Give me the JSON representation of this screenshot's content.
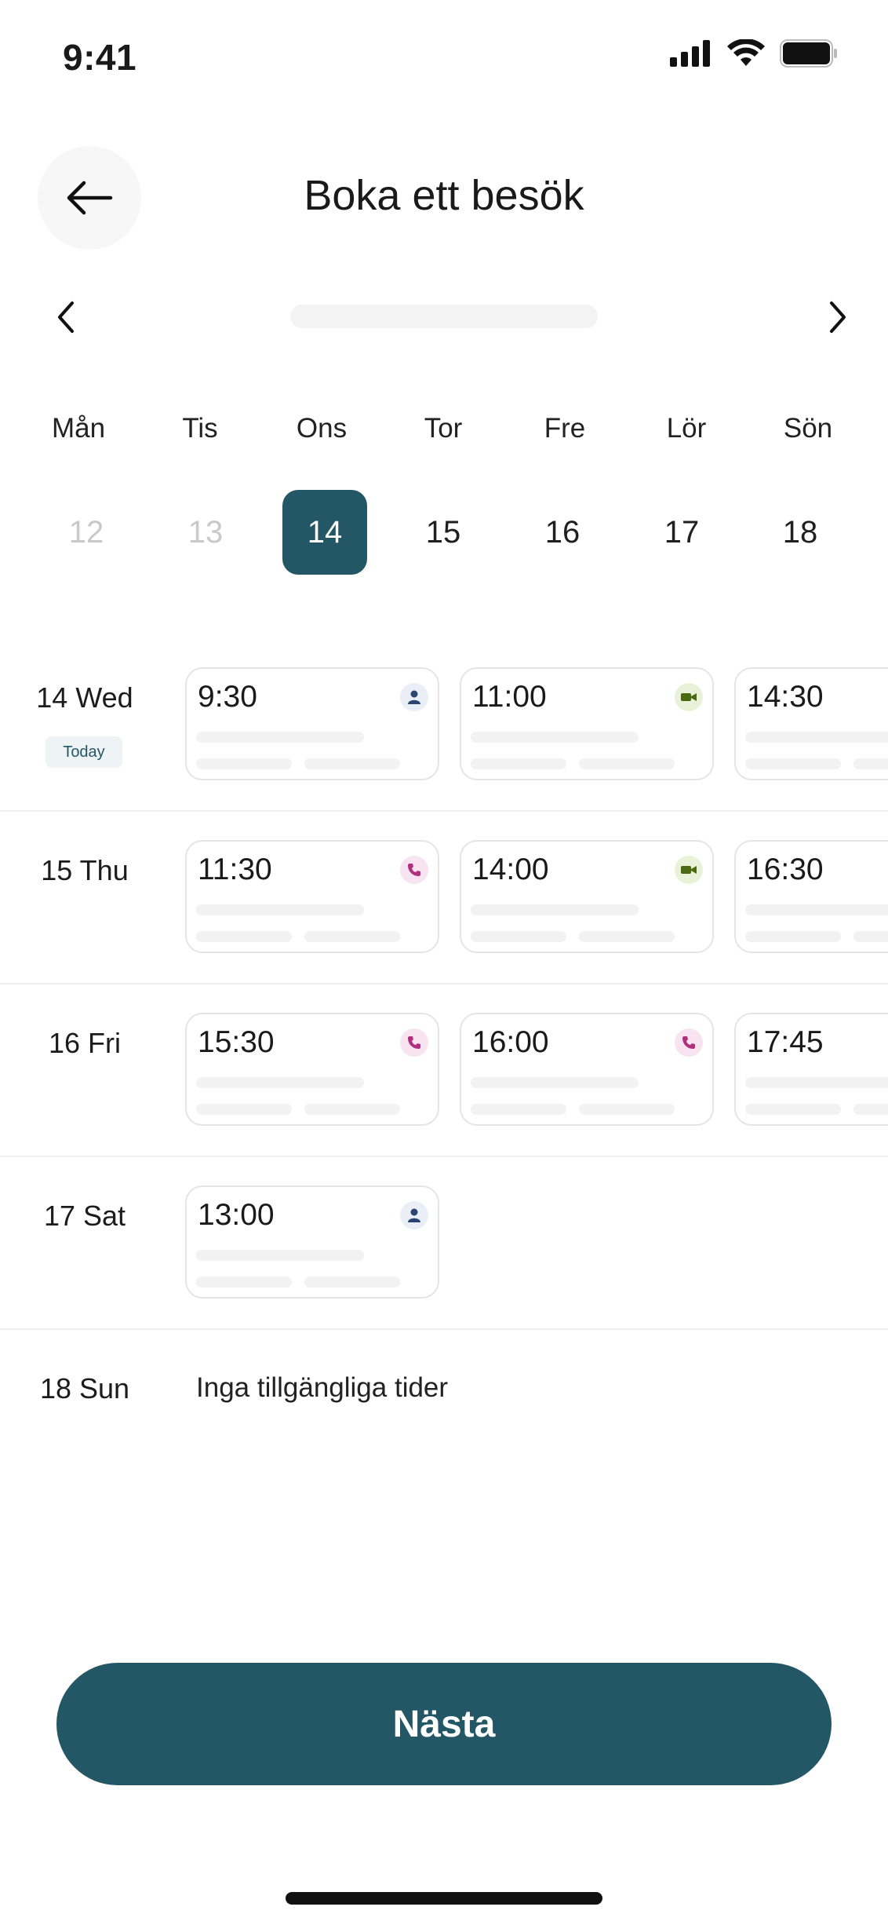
{
  "status_bar": {
    "time": "9:41"
  },
  "header": {
    "title": "Boka ett besök"
  },
  "calendar": {
    "weekdays": [
      "Mån",
      "Tis",
      "Ons",
      "Tor",
      "Fre",
      "Lör",
      "Sön"
    ],
    "dates": [
      {
        "label": "12",
        "state": "past"
      },
      {
        "label": "13",
        "state": "past"
      },
      {
        "label": "14",
        "state": "selected"
      },
      {
        "label": "15",
        "state": "normal"
      },
      {
        "label": "16",
        "state": "normal"
      },
      {
        "label": "17",
        "state": "normal"
      },
      {
        "label": "18",
        "state": "normal"
      }
    ]
  },
  "days": [
    {
      "label": "14 Wed",
      "badge": "Today",
      "slots": [
        {
          "time": "9:30",
          "type": "person"
        },
        {
          "time": "11:00",
          "type": "video"
        },
        {
          "time": "14:30",
          "type": "person"
        }
      ]
    },
    {
      "label": "15 Thu",
      "slots": [
        {
          "time": "11:30",
          "type": "phone"
        },
        {
          "time": "14:00",
          "type": "video"
        },
        {
          "time": "16:30",
          "type": "person"
        }
      ]
    },
    {
      "label": "16 Fri",
      "slots": [
        {
          "time": "15:30",
          "type": "phone"
        },
        {
          "time": "16:00",
          "type": "phone"
        },
        {
          "time": "17:45",
          "type": "person"
        }
      ]
    },
    {
      "label": "17 Sat",
      "slots": [
        {
          "time": "13:00",
          "type": "person"
        }
      ]
    },
    {
      "label": "18 Sun",
      "empty_text": "Inga tillgängliga tider",
      "slots": []
    }
  ],
  "footer": {
    "next_label": "Nästa"
  },
  "colors": {
    "primary": "#245766",
    "person_icon": "#2b4670",
    "video_icon": "#4b6b12",
    "phone_icon": "#b0307e"
  }
}
